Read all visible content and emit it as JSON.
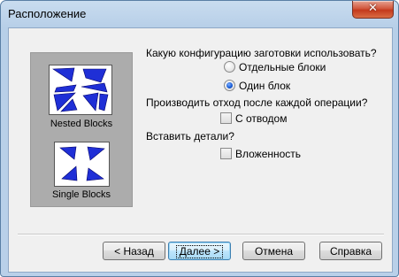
{
  "window": {
    "title": "Расположение",
    "close_glyph": "✕"
  },
  "preview": {
    "nested_label": "Nested Blocks",
    "single_label": "Single Blocks",
    "shape_color": "#1f2fd6"
  },
  "config": {
    "question": "Какую конфигурацию заготовки использовать?",
    "options": [
      {
        "label": "Отдельные блоки",
        "selected": false
      },
      {
        "label": "Один блок",
        "selected": true
      }
    ]
  },
  "scrap": {
    "question": "Производить отход после каждой операции?",
    "checkbox_label": "С отводом",
    "checked": false
  },
  "insert": {
    "question": "Вставить детали?",
    "checkbox_label": "Вложенность",
    "checked": false
  },
  "buttons": {
    "back": "< Назад",
    "next": "Далее >",
    "cancel": "Отмена",
    "help": "Справка"
  }
}
